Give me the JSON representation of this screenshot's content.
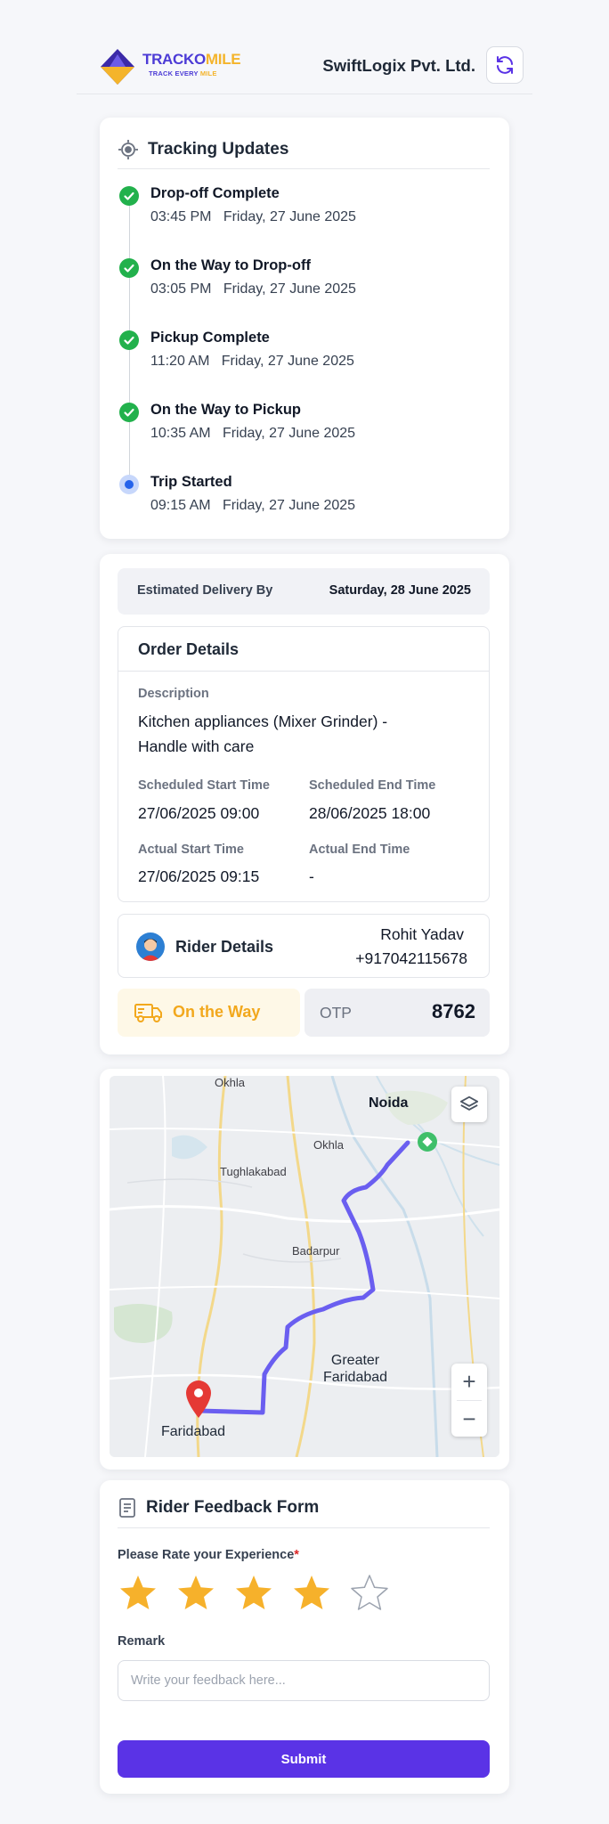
{
  "header": {
    "brand_part1": "TRACKO",
    "brand_part2": "MILE",
    "tagline_part1": "TRACK EVERY ",
    "tagline_part2": "MILE",
    "company": "SwiftLogix Pvt. Ltd."
  },
  "tracking": {
    "title": "Tracking Updates",
    "updates": [
      {
        "title": "Drop-off Complete",
        "time": "03:45 PM   Friday, 27 June 2025",
        "status": "done"
      },
      {
        "title": "On the Way to Drop-off",
        "time": "03:05 PM   Friday, 27 June 2025",
        "status": "done"
      },
      {
        "title": "Pickup Complete",
        "time": "11:20 AM   Friday, 27 June 2025",
        "status": "done"
      },
      {
        "title": "On the Way to Pickup",
        "time": "10:35 AM   Friday, 27 June 2025",
        "status": "done"
      },
      {
        "title": "Trip Started",
        "time": "09:15 AM   Friday, 27 June 2025",
        "status": "current"
      }
    ]
  },
  "order": {
    "estimated_label": "Estimated Delivery By",
    "estimated_value": "Saturday, 28 June 2025",
    "title": "Order Details",
    "description_label": "Description",
    "description": "Kitchen appliances (Mixer Grinder) - Handle with care",
    "sched_start_label": "Scheduled Start Time",
    "sched_start": "27/06/2025 09:00",
    "sched_end_label": "Scheduled End Time",
    "sched_end": "28/06/2025 18:00",
    "actual_start_label": "Actual Start Time",
    "actual_start": "27/06/2025 09:15",
    "actual_end_label": "Actual End Time",
    "actual_end": "-"
  },
  "rider": {
    "label": "Rider Details",
    "name": "Rohit Yadav",
    "phone": "+917042115678"
  },
  "status": {
    "label": "On the Way",
    "otp_label": "OTP",
    "otp_value": "8762"
  },
  "map": {
    "labels": {
      "okhla_top": "Okhla",
      "noida": "Noida",
      "okhla": "Okhla",
      "tughlakabad": "Tughlakabad",
      "badarpur": "Badarpur",
      "greater_faridabad": "Greater\nFaridabad",
      "faridabad": "Faridabad"
    },
    "zoom_in": "+",
    "zoom_out": "−"
  },
  "feedback": {
    "title": "Rider Feedback Form",
    "rate_label": "Please Rate your Experience",
    "required_mark": "*",
    "rating": 4,
    "max_rating": 5,
    "remark_label": "Remark",
    "remark_placeholder": "Write your feedback here...",
    "submit_label": "Submit"
  },
  "colors": {
    "accent": "#5a33e6",
    "success": "#22b14c",
    "warning": "#f2a81d",
    "star": "#f6b12b",
    "route": "#6a5ef0"
  },
  "icons": [
    "logo-icon",
    "refresh-icon",
    "location-target-icon",
    "check-icon",
    "document-icon",
    "avatar-icon",
    "delivery-truck-icon",
    "layers-icon",
    "map-pin-icon",
    "destination-marker-icon",
    "star-icon"
  ]
}
